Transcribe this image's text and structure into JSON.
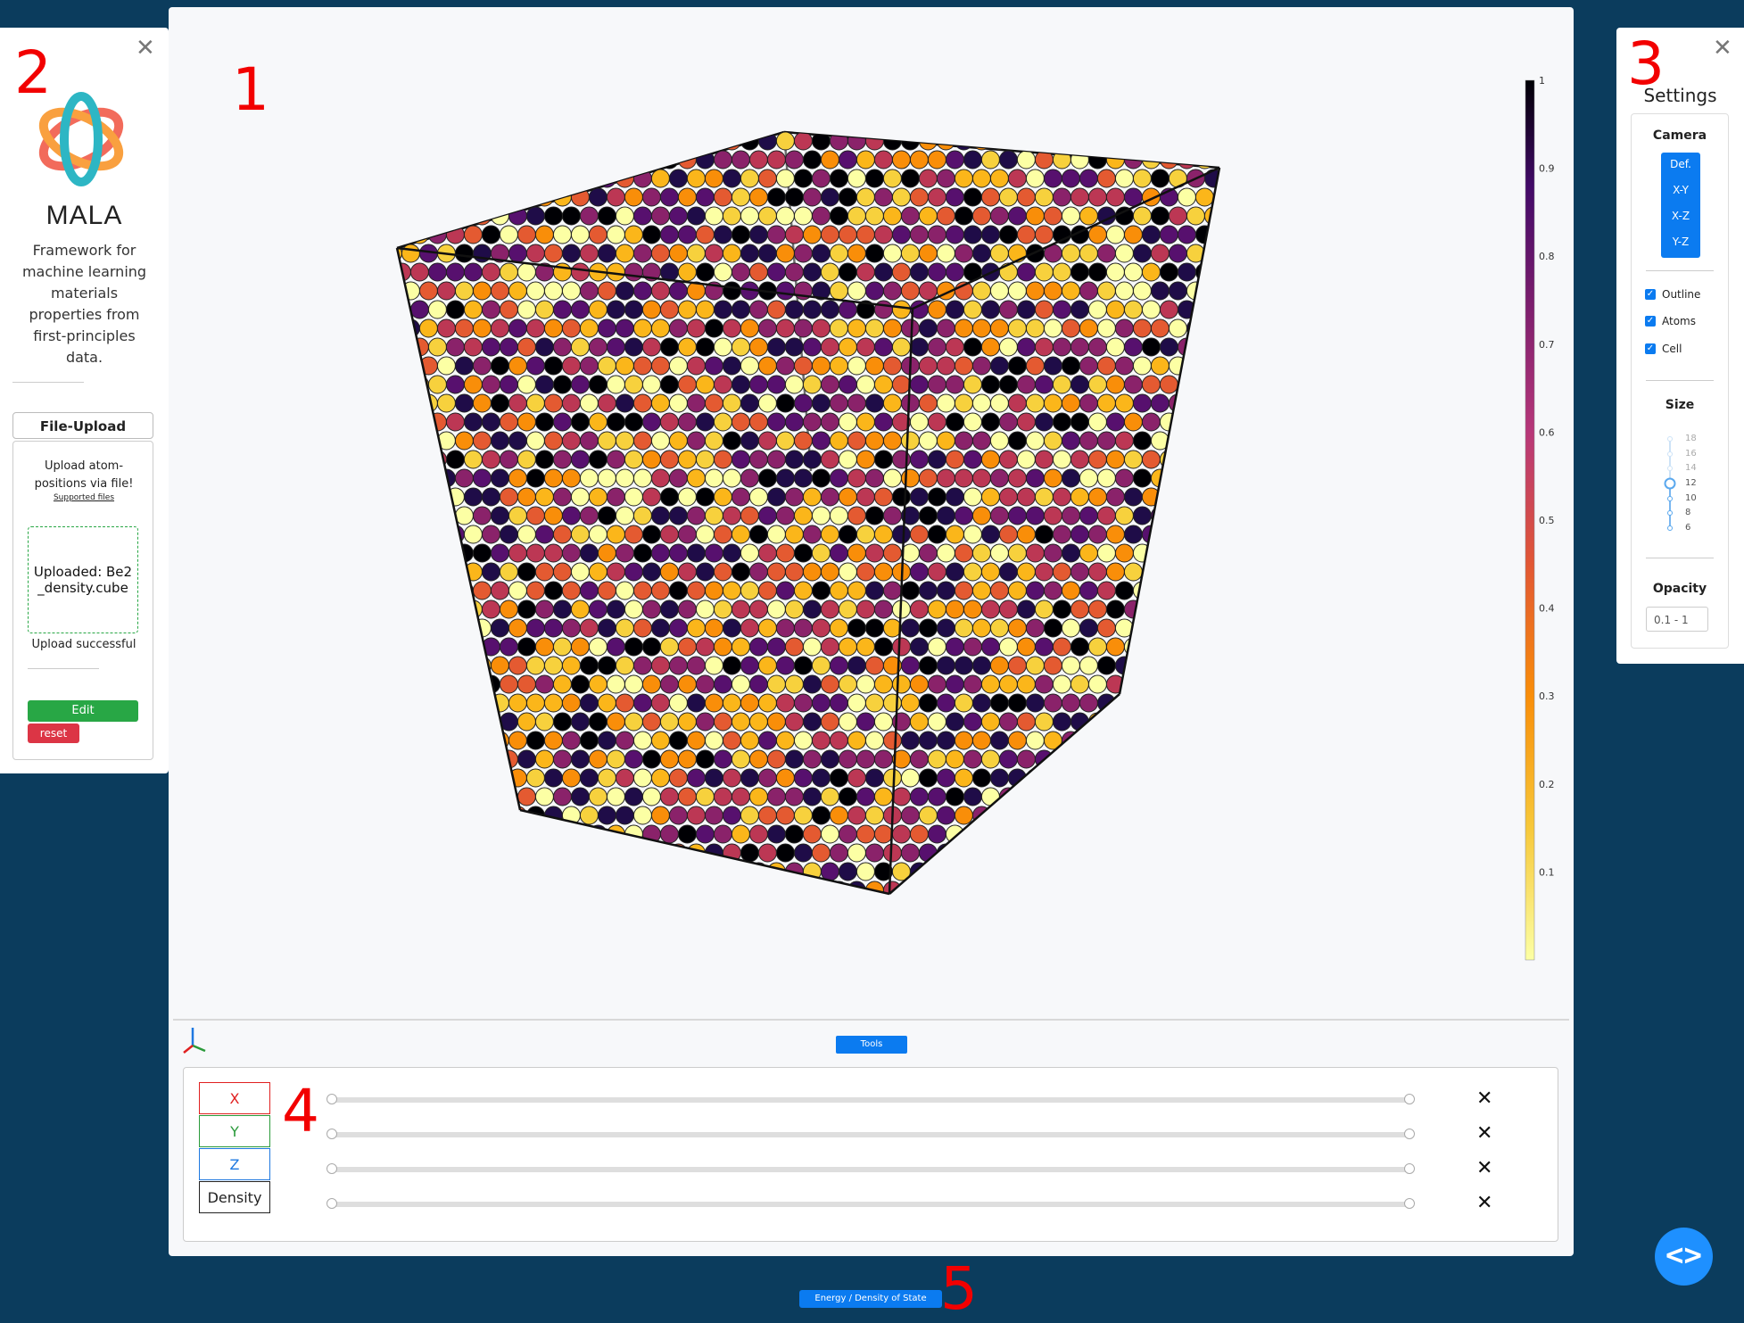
{
  "annotations": [
    "1",
    "2",
    "3",
    "4",
    "5"
  ],
  "left_panel": {
    "title": "MALA",
    "description": "Framework for machine learning materials properties from first-principles data.",
    "upload_tab": "File-Upload",
    "upload_prompt": "Upload atom-positions via file!",
    "supported_files": "Supported files",
    "uploaded_text": "Uploaded: Be2_density.cube",
    "upload_status": "Upload successful",
    "edit_label": "Edit",
    "reset_label": "reset",
    "logo_colors": [
      "#2db6c4",
      "#f26b5b",
      "#f9a03f"
    ]
  },
  "right_panel": {
    "title": "Settings",
    "camera_title": "Camera",
    "camera_buttons": [
      "Def.",
      "X-Y",
      "X-Z",
      "Y-Z"
    ],
    "checkboxes": [
      {
        "label": "Outline",
        "checked": true
      },
      {
        "label": "Atoms",
        "checked": true
      },
      {
        "label": "Cell",
        "checked": true
      }
    ],
    "size_title": "Size",
    "size_ticks": [
      "18",
      "16",
      "14",
      "12",
      "10",
      "8",
      "6"
    ],
    "size_value": "12",
    "opacity_title": "Opacity",
    "opacity_value": "0.1 - 1"
  },
  "viewer": {
    "colorbar_ticks": [
      "1",
      "0.9",
      "0.8",
      "0.7",
      "0.6",
      "0.5",
      "0.4",
      "0.3",
      "0.2",
      "0.1"
    ],
    "colormap": "inferno",
    "tools_label": "Tools"
  },
  "tools_panel": {
    "axes": [
      {
        "label": "X",
        "color": "#e02020"
      },
      {
        "label": "Y",
        "color": "#2a9a3a"
      },
      {
        "label": "Z",
        "color": "#1e78e0"
      },
      {
        "label": "Density",
        "color": "#222222"
      }
    ],
    "slider_range": [
      0,
      1
    ]
  },
  "bottom": {
    "energy_label": "Energy / Density of State"
  },
  "colors": {
    "background": "#0b3c5d",
    "accent": "#0b7bf0",
    "success": "#28a745",
    "danger": "#dc3545"
  }
}
